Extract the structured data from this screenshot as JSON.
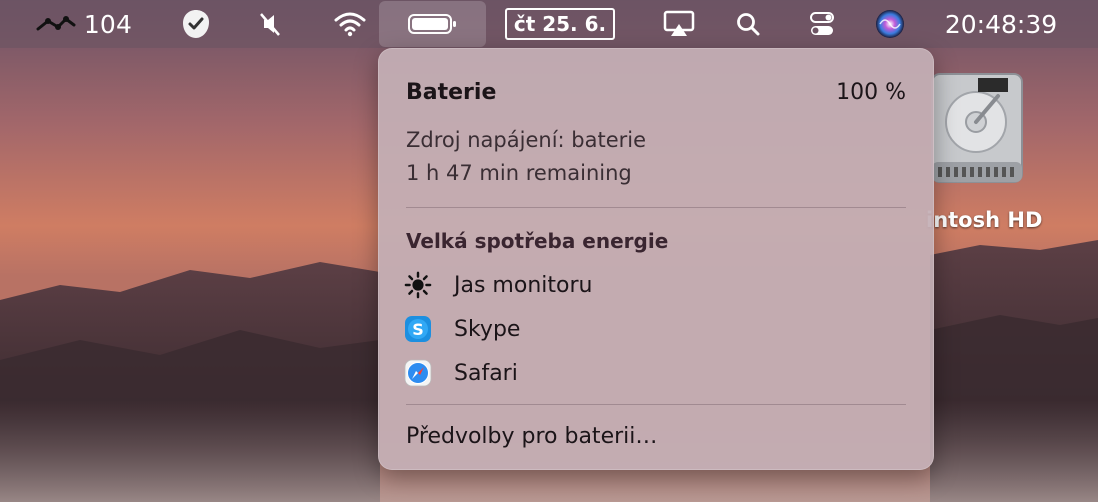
{
  "menubar": {
    "stocks_value": "104",
    "date": "čt 25. 6.",
    "time": "20:48:39"
  },
  "battery_popup": {
    "title": "Baterie",
    "percent": "100 %",
    "power_source": "Zdroj napájení: baterie",
    "remaining": "1 h 47 min remaining",
    "section_heading": "Velká spotřeba energie",
    "apps": [
      {
        "label": "Jas monitoru",
        "icon": "brightness-icon"
      },
      {
        "label": "Skype",
        "icon": "skype-icon"
      },
      {
        "label": "Safari",
        "icon": "safari-icon"
      }
    ],
    "footer": "Předvolby pro baterii…"
  },
  "desktop": {
    "drive_label": "intosh HD"
  }
}
